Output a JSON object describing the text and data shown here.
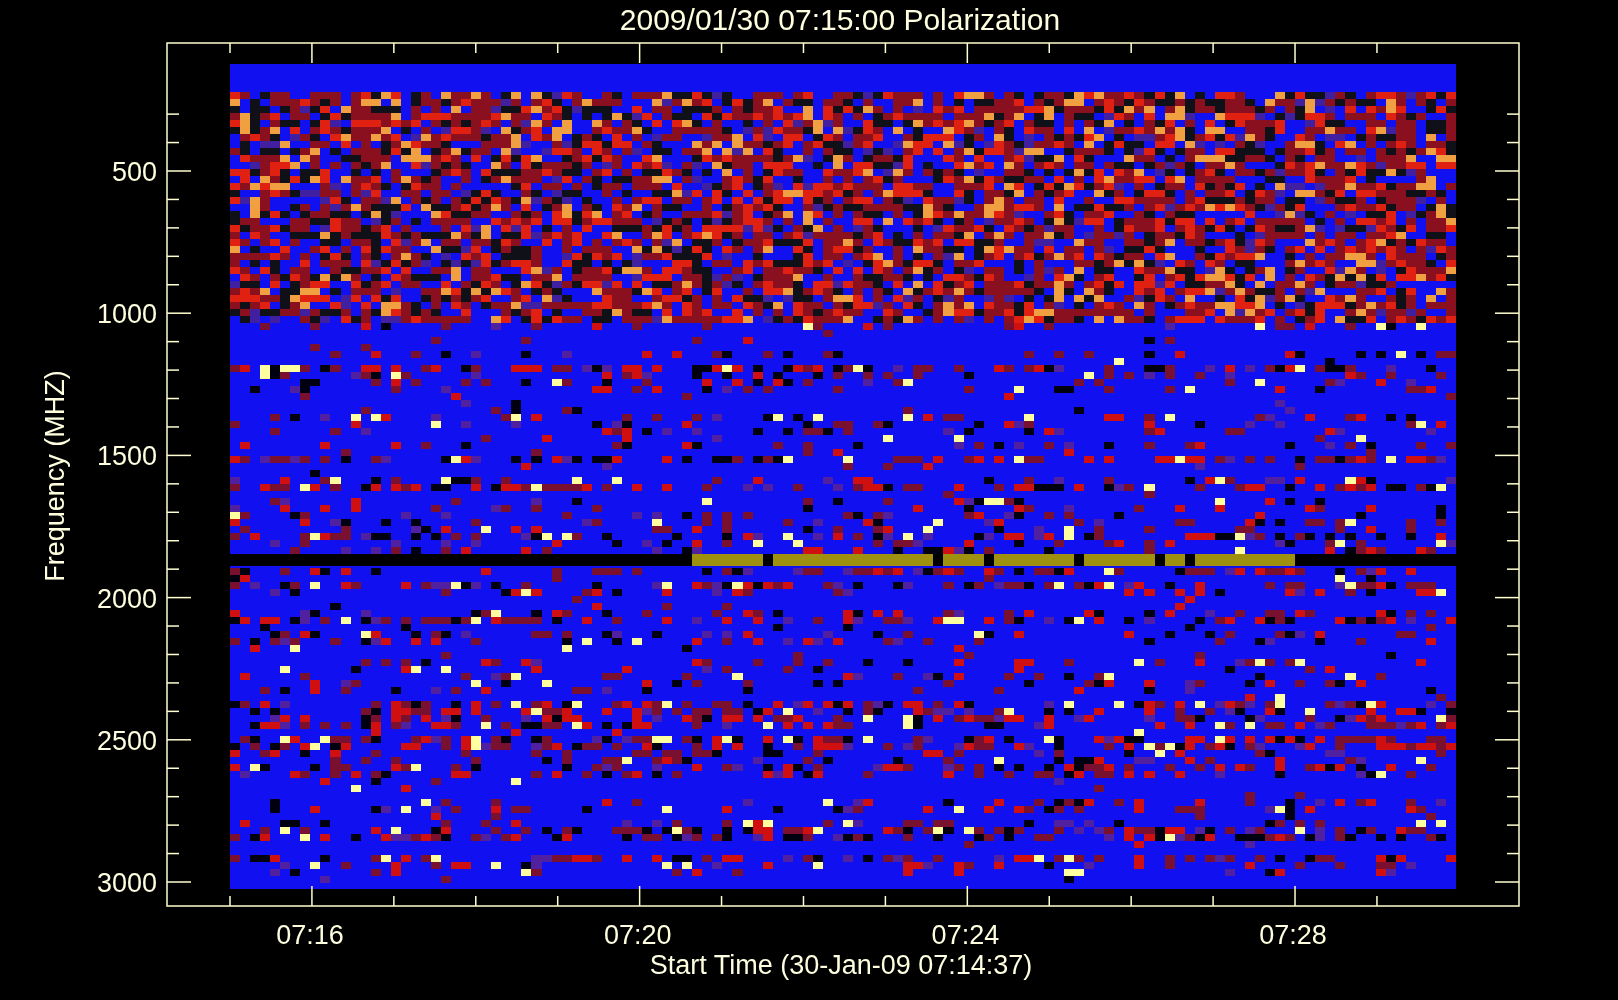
{
  "title": "2009/01/30 07:15:00 Polarization",
  "plot": {
    "ylabel": "Frequency (MHZ)",
    "xlabel": "Start Time (30-Jan-09 07:14:37)",
    "yticks": [
      "500",
      "1000",
      "1500",
      "2000",
      "2500",
      "3000"
    ],
    "xticks": [
      "07:16",
      "07:20",
      "07:24",
      "07:28"
    ]
  }
}
